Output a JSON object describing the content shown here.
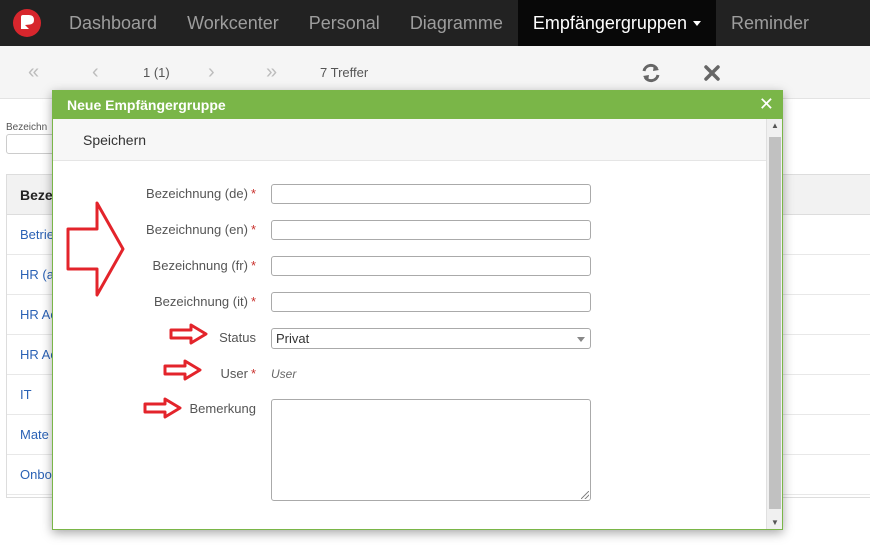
{
  "nav": {
    "items": [
      {
        "label": "Dashboard"
      },
      {
        "label": "Workcenter"
      },
      {
        "label": "Personal"
      },
      {
        "label": "Diagramme"
      },
      {
        "label": "Empfängergruppen"
      },
      {
        "label": "Reminder"
      }
    ],
    "active_index": 4
  },
  "toolbar": {
    "page": "1 (1)",
    "hits": "7 Treffer",
    "icons": [
      "first-page-icon",
      "prev-page-icon",
      "next-page-icon",
      "last-page-icon",
      "refresh-icon",
      "close-icon"
    ]
  },
  "background": {
    "filter_label": "Bezeichn",
    "table_header": "Bezei",
    "rows": [
      "Betrie",
      "HR (a",
      "HR Ac",
      "HR Ac",
      "IT",
      "Mate",
      "Onbo"
    ]
  },
  "modal": {
    "title": "Neue Empfängergruppe",
    "save_label": "Speichern",
    "fields": {
      "name_de": {
        "label": "Bezeichnung (de)",
        "required": "*",
        "value": ""
      },
      "name_en": {
        "label": "Bezeichnung (en)",
        "required": "*",
        "value": ""
      },
      "name_fr": {
        "label": "Bezeichnung (fr)",
        "required": "*",
        "value": ""
      },
      "name_it": {
        "label": "Bezeichnung (it)",
        "required": "*",
        "value": ""
      },
      "status": {
        "label": "Status",
        "value": "Privat"
      },
      "user": {
        "label": "User",
        "required": "*",
        "value": "User"
      },
      "remark": {
        "label": "Bemerkung",
        "value": ""
      }
    }
  },
  "colors": {
    "nav_bg": "#222222",
    "modal_accent": "#7ab648",
    "link": "#2b62b5",
    "required": "#c9302c",
    "annotation": "#e3242b"
  }
}
